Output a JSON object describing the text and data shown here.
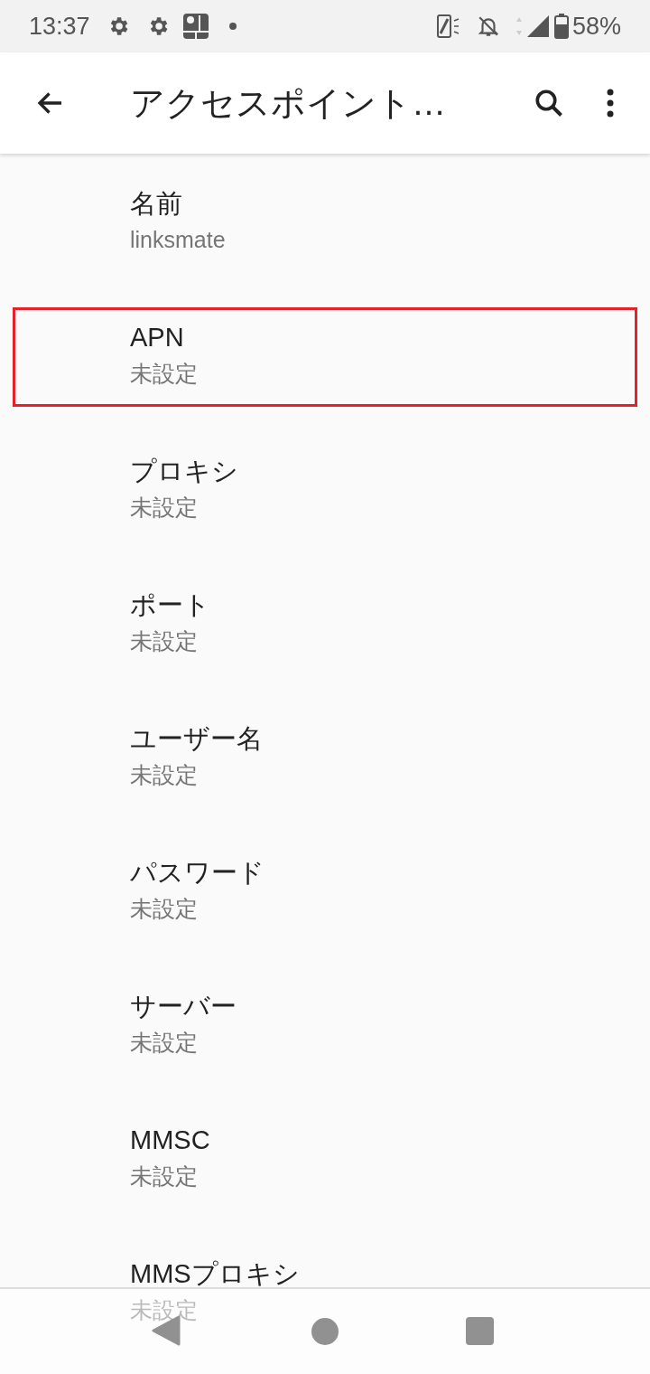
{
  "status_bar": {
    "time": "13:37",
    "battery": "58%"
  },
  "app_bar": {
    "title": "アクセスポイント…"
  },
  "items": [
    {
      "title": "名前",
      "value": "linksmate",
      "highlighted": false
    },
    {
      "title": "APN",
      "value": "未設定",
      "highlighted": true
    },
    {
      "title": "プロキシ",
      "value": "未設定",
      "highlighted": false
    },
    {
      "title": "ポート",
      "value": "未設定",
      "highlighted": false
    },
    {
      "title": "ユーザー名",
      "value": "未設定",
      "highlighted": false
    },
    {
      "title": "パスワード",
      "value": "未設定",
      "highlighted": false
    },
    {
      "title": "サーバー",
      "value": "未設定",
      "highlighted": false
    },
    {
      "title": "MMSC",
      "value": "未設定",
      "highlighted": false
    },
    {
      "title": "MMSプロキシ",
      "value": "未設定",
      "highlighted": false
    }
  ]
}
